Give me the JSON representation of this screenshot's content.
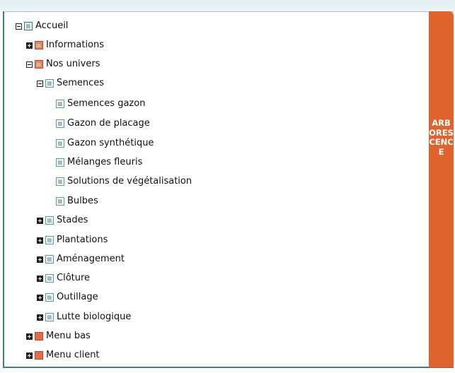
{
  "tree": {
    "nodes": [
      {
        "label": "Accueil",
        "toggle": "minus"
      },
      {
        "label": "Informations",
        "toggle": "plus"
      },
      {
        "label": "Nos univers",
        "toggle": "minus"
      },
      {
        "label": "Semences",
        "toggle": "minus"
      },
      {
        "label": "Semences gazon",
        "toggle": "none"
      },
      {
        "label": "Gazon de placage",
        "toggle": "none"
      },
      {
        "label": "Gazon synthétique",
        "toggle": "none"
      },
      {
        "label": "Mélanges fleuris",
        "toggle": "none"
      },
      {
        "label": "Solutions de végétalisation",
        "toggle": "none"
      },
      {
        "label": "Bulbes",
        "toggle": "none"
      },
      {
        "label": "Stades",
        "toggle": "plus"
      },
      {
        "label": "Plantations",
        "toggle": "plus"
      },
      {
        "label": "Aménagement",
        "toggle": "plus"
      },
      {
        "label": "Clôture",
        "toggle": "plus"
      },
      {
        "label": "Outillage",
        "toggle": "plus"
      },
      {
        "label": "Lutte biologique",
        "toggle": "plus"
      },
      {
        "label": "Menu bas",
        "toggle": "plus"
      },
      {
        "label": "Menu client",
        "toggle": "plus"
      }
    ]
  },
  "side_tab": {
    "label": "ARBORESCENCE"
  },
  "colors": {
    "accent_orange": "#e0632e",
    "frame_border": "#3f7f86",
    "page_icon_blue": "#4f9ab9"
  },
  "icons": {
    "root": "page-icon",
    "section_red": "red-page-icon",
    "section_blue": "page-icon",
    "menu": "red-square-icon",
    "toggle_expand": "plus-box-icon",
    "toggle_collapse": "minus-box-icon"
  }
}
